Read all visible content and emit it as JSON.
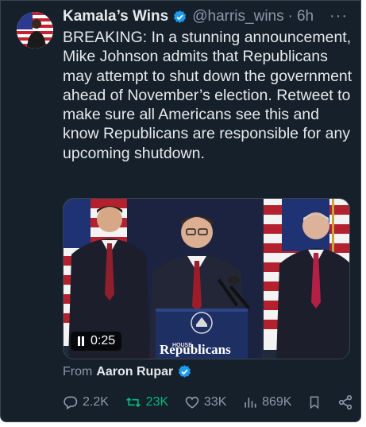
{
  "tweet": {
    "display_name": "Kamala’s Wins",
    "handle": "@harris_wins",
    "separator": "·",
    "time": "6h",
    "more": "···",
    "text": "BREAKING: In a stunning announcement, Mike Johnson admits that Republicans may attempt to shut down the government ahead of November’s election. Retweet to make sure all Americans see this and know Republicans are responsible for any upcoming shutdown."
  },
  "media": {
    "video_time": "0:25",
    "podium_top": "HOUSE",
    "podium_main": "Republicans"
  },
  "attribution": {
    "prefix": "From",
    "name": "Aaron Rupar"
  },
  "actions": {
    "replies": "2.2K",
    "retweets": "23K",
    "likes": "33K",
    "views": "869K"
  },
  "colors": {
    "background": "#15202b",
    "text": "#e7e9ea",
    "secondary": "#8b98a5",
    "verified": "#1d9bf0",
    "retweet": "#00ba7c"
  },
  "icons": [
    "verified-badge-icon",
    "more-icon",
    "pause-icon",
    "reply-icon",
    "retweet-icon",
    "like-icon",
    "views-icon",
    "bookmark-icon",
    "share-icon"
  ]
}
